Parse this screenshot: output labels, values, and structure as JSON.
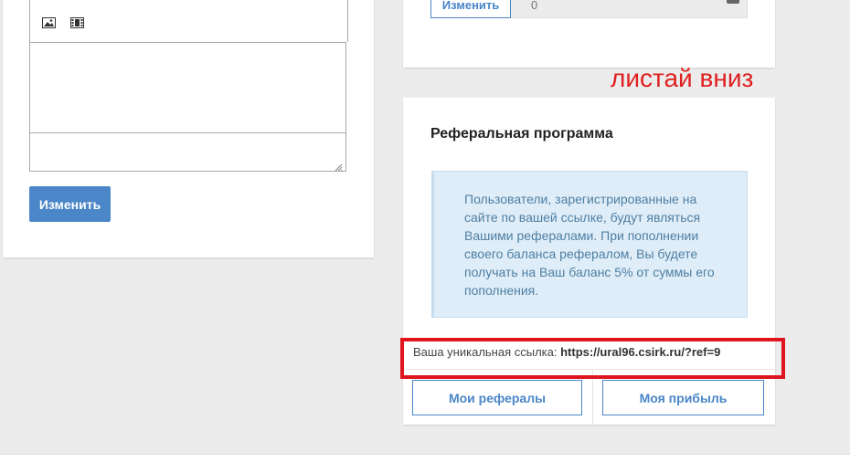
{
  "left_card": {
    "toolbar": {
      "image_icon": "image-icon",
      "video_icon": "film-icon"
    },
    "submit_label": "Изменить"
  },
  "top_right_card": {
    "change_label": "Изменить",
    "field_value": "0"
  },
  "annotation": {
    "text": "листай вниз",
    "color": "#e02020"
  },
  "referral": {
    "title": "Реферальная программа",
    "info": "Пользователи, зарегистрированные на сайте по вашей ссылке, будут являться Вашими рефералами. При пополнении своего баланса рефералом, Вы будете получать на Ваш баланс 5% от суммы его пополнения.",
    "link_label": "Ваша уникальная ссылка:",
    "link_value": "https://ural96.csirk.ru/?ref=9",
    "my_referrals_label": "Мои рефералы",
    "my_profit_label": "Моя прибыль"
  },
  "colors": {
    "accent": "#4a86c8",
    "info_bg": "#dfedf8",
    "highlight": "#e0141e"
  }
}
